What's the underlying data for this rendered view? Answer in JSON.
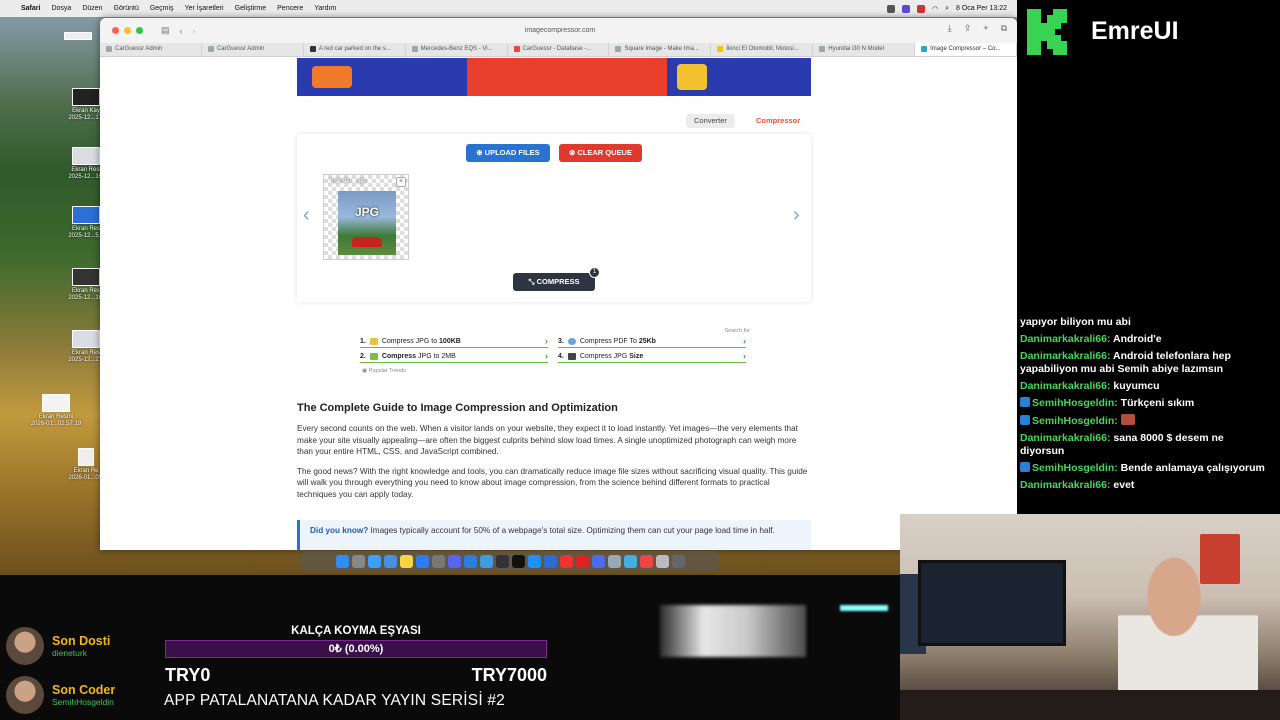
{
  "menubar": {
    "app": "Safari",
    "items": [
      "Dosya",
      "Düzen",
      "Görüntü",
      "Geçmiş",
      "Yer İşaretleri",
      "Geliştirme",
      "Pencere",
      "Yardım"
    ],
    "clock": "8 Oca Per  13:22"
  },
  "desktop_items": [
    {
      "label": "Ekran Kay\n2025-12...17."
    },
    {
      "label": "Ekran Resi\n2025-12...19."
    },
    {
      "label": "Ekran Res\n2025-12...5.3"
    },
    {
      "label": "Ekran Res\n2025-12...16."
    },
    {
      "label": "Ekran Res\n2025-12...21."
    },
    {
      "label": "Ekran Resmi\n2026-01...02.57.19"
    },
    {
      "label": "Ekran Re\n2026-01...05."
    }
  ],
  "browser": {
    "url": "imagecompressor.com",
    "tabs": [
      "CarGuessr Admin",
      "CarGuessr Admin",
      "A red car parked on the s...",
      "Mercedes-Benz EQS - Vi...",
      "CarGuessr - Database -...",
      "Square Image - Make Ima...",
      "İkinci El Otomobil, Motosi...",
      "Hyundai i30 N Model",
      "Image Compressor – Co..."
    ]
  },
  "site": {
    "mode_tabs": {
      "converter": "Converter",
      "compressor": "Compressor"
    },
    "upload_label": "UPLOAD FILES",
    "clear_label": "CLEAR QUEUE",
    "file_name": "hyundai....jpg",
    "file_type": "JPG",
    "compress_label": "COMPRESS",
    "queue_count": "1",
    "ads": {
      "header": "Search for",
      "items": [
        {
          "num": "1.",
          "text": "Compress JPG to ",
          "bold": "100KB"
        },
        {
          "num": "2.",
          "text": "Compress",
          "bold2": " JPG to 2MB",
          "bold": ""
        },
        {
          "num": "3.",
          "text": "Compress PDF To ",
          "bold": "25Kb"
        },
        {
          "num": "4.",
          "text": "Compress JPG ",
          "bold": "Size"
        }
      ],
      "footer": "Popular Trends"
    },
    "article": {
      "title": "The Complete Guide to Image Compression and Optimization",
      "p1": "Every second counts on the web. When a visitor lands on your website, they expect it to load instantly. Yet images—the very elements that make your site visually appealing—are often the biggest culprits behind slow load times. A single unoptimized photograph can weigh more than your entire HTML, CSS, and JavaScript combined.",
      "p2": "The good news? With the right knowledge and tools, you can dramatically reduce image file sizes without sacrificing visual quality. This guide will walk you through everything you need to know about image compression, from the science behind different formats to practical techniques you can apply today.",
      "callout_lead": "Did you know?",
      "callout_text": " Images typically account for 50% of a webpage's total size. Optimizing them can cut your page load time in half."
    }
  },
  "stream": {
    "brand": "EmreUI",
    "chat": [
      {
        "user": "",
        "msg": "yapıyor biliyon mu abi"
      },
      {
        "user": "Danimarkakrali66:",
        "msg": " Android'e"
      },
      {
        "user": "Danimarkakrali66:",
        "msg": " Android telefonlara hep yapabiliyon mu abi Semih abiye lazımsın"
      },
      {
        "user": "Danimarkakrali66:",
        "msg": " kuyumcu"
      },
      {
        "user": "SemihHosgeldin:",
        "msg": " Türkçeni sıkım",
        "badge": true
      },
      {
        "user": "SemihHosgeldin:",
        "msg": " ",
        "badge": true,
        "emote": true
      },
      {
        "user": "Danimarkakrali66:",
        "msg": " sana 8000 $ desem ne diyorsun"
      },
      {
        "user": "SemihHosgeldin:",
        "msg": " Bende anlamaya çalışıyorum",
        "badge": true
      },
      {
        "user": "Danimarkakrali66:",
        "msg": " evet"
      }
    ],
    "last_follower": {
      "title": "Son Dosti",
      "name": "dieneturk"
    },
    "last_coder": {
      "title": "Son Coder",
      "name": "SemihHosgeldin"
    },
    "goal": {
      "title": "KALÇA KOYMA EŞYASI",
      "progress_text": "0₺ (0.00%)",
      "progress_fraction": 0.0,
      "min": "TRY0",
      "max": "TRY7000"
    },
    "series_title": "APP PATALANATANA KADAR YAYIN SERİSİ #2"
  },
  "colors": {
    "accent_blue": "#2773cf",
    "danger_red": "#e0392f",
    "compressor_orange": "#e8522f",
    "chat_user_green": "#49d65a",
    "goal_purple": "#9a2cc6",
    "brand_green": "#39d353"
  }
}
